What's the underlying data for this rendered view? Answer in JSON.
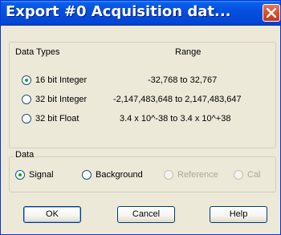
{
  "window": {
    "title": "Export #0   Acquisition dat..."
  },
  "data_types_group": {
    "header_types": "Data Types",
    "header_range": "Range",
    "options": [
      {
        "label": "16 bit Integer",
        "range": "-32,768  to  32,767",
        "checked": true
      },
      {
        "label": "32 bit Integer",
        "range": "-2,147,483,648  to 2,147,483,647",
        "checked": false
      },
      {
        "label": "32 bit Float",
        "range": "3.4 x 10^-38  to  3.4 x 10^+38",
        "checked": false
      }
    ]
  },
  "data_group": {
    "legend": "Data",
    "options": [
      {
        "label": "Signal",
        "checked": true,
        "enabled": true
      },
      {
        "label": "Background",
        "checked": false,
        "enabled": true
      },
      {
        "label": "Reference",
        "checked": false,
        "enabled": false
      },
      {
        "label": "Cal",
        "checked": false,
        "enabled": false
      }
    ]
  },
  "buttons": {
    "ok": "OK",
    "cancel": "Cancel",
    "help": "Help"
  }
}
